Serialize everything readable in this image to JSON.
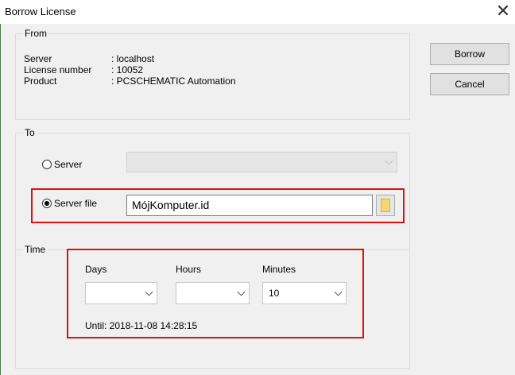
{
  "window": {
    "title": "Borrow License",
    "close_glyph": "✕"
  },
  "from": {
    "title": "From",
    "rows": [
      {
        "label": "Server",
        "value": ": localhost"
      },
      {
        "label": "License number",
        "value": ": 10052"
      },
      {
        "label": "Product",
        "value": ": PCSCHEMATIC Automation"
      }
    ]
  },
  "buttons": {
    "borrow": "Borrow",
    "cancel": "Cancel"
  },
  "to": {
    "title": "To",
    "server_label": "Server",
    "server_file_label": "Server file",
    "server_file_value": "MójKomputer.id",
    "selected": "server_file"
  },
  "time": {
    "title": "Time",
    "days_label": "Days",
    "hours_label": "Hours",
    "minutes_label": "Minutes",
    "days_value": "",
    "hours_value": "",
    "minutes_value": "10",
    "until_text": "Until: 2018-11-08 14:28:15"
  },
  "colors": {
    "highlight": "#e01010",
    "folder": "#f5d76e",
    "background": "#f0f0f0"
  },
  "icons": [
    "close-icon",
    "folder-icon",
    "chevron-down-icon"
  ]
}
